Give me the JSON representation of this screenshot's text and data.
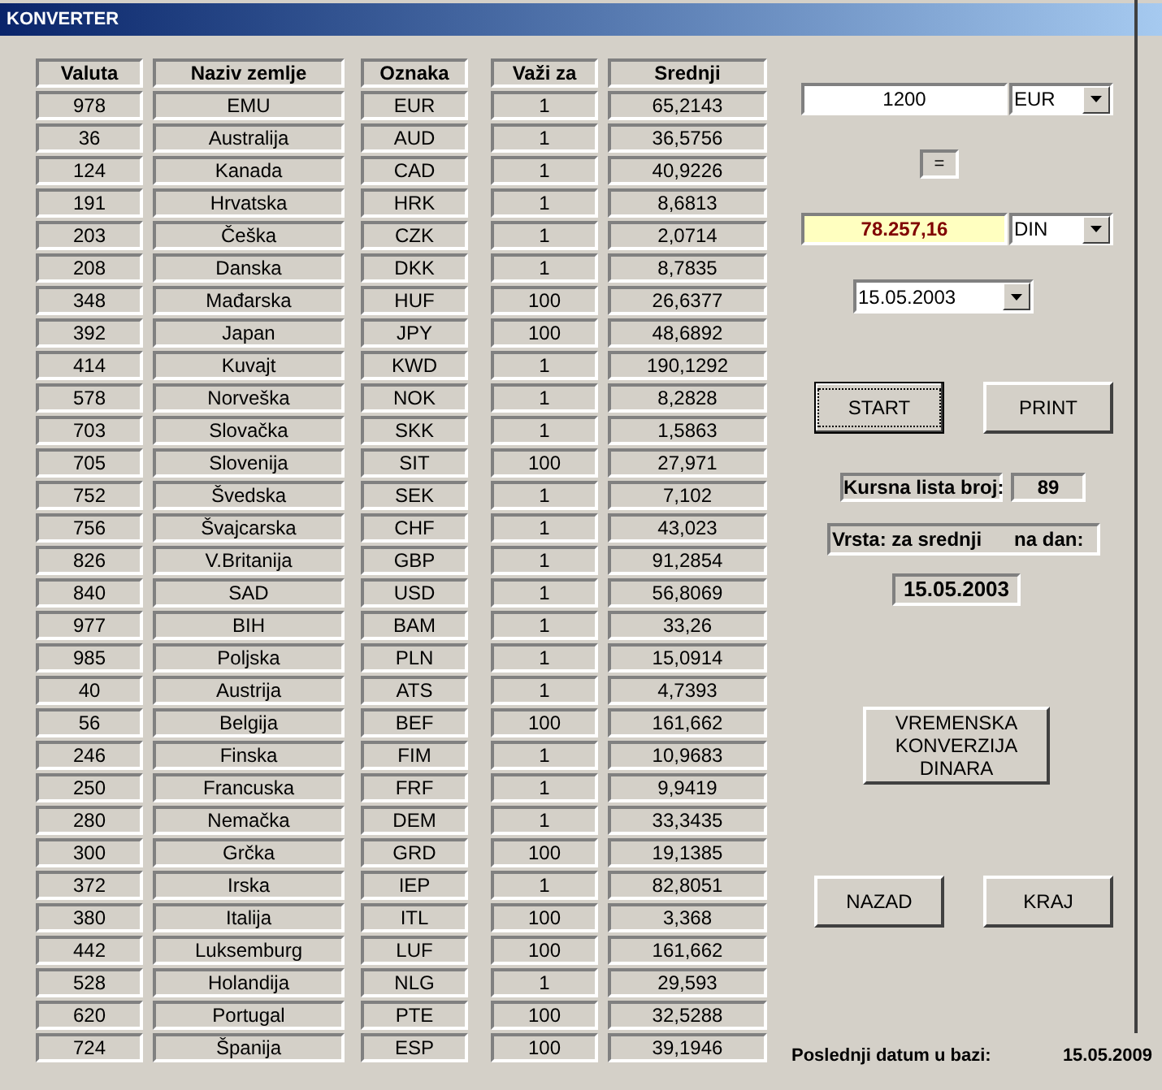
{
  "window": {
    "title": "KONVERTER"
  },
  "table": {
    "columns": [
      "Valuta",
      "Naziv zemlje",
      "Oznaka",
      "Važi za",
      "Srednji"
    ],
    "rows": [
      [
        "978",
        "EMU",
        "EUR",
        "1",
        "65,2143"
      ],
      [
        "36",
        "Australija",
        "AUD",
        "1",
        "36,5756"
      ],
      [
        "124",
        "Kanada",
        "CAD",
        "1",
        "40,9226"
      ],
      [
        "191",
        "Hrvatska",
        "HRK",
        "1",
        "8,6813"
      ],
      [
        "203",
        "Češka",
        "CZK",
        "1",
        "2,0714"
      ],
      [
        "208",
        "Danska",
        "DKK",
        "1",
        "8,7835"
      ],
      [
        "348",
        "Mađarska",
        "HUF",
        "100",
        "26,6377"
      ],
      [
        "392",
        "Japan",
        "JPY",
        "100",
        "48,6892"
      ],
      [
        "414",
        "Kuvajt",
        "KWD",
        "1",
        "190,1292"
      ],
      [
        "578",
        "Norveška",
        "NOK",
        "1",
        "8,2828"
      ],
      [
        "703",
        "Slovačka",
        "SKK",
        "1",
        "1,5863"
      ],
      [
        "705",
        "Slovenija",
        "SIT",
        "100",
        "27,971"
      ],
      [
        "752",
        "Švedska",
        "SEK",
        "1",
        "7,102"
      ],
      [
        "756",
        "Švajcarska",
        "CHF",
        "1",
        "43,023"
      ],
      [
        "826",
        "V.Britanija",
        "GBP",
        "1",
        "91,2854"
      ],
      [
        "840",
        "SAD",
        "USD",
        "1",
        "56,8069"
      ],
      [
        "977",
        "BIH",
        "BAM",
        "1",
        "33,26"
      ],
      [
        "985",
        "Poljska",
        "PLN",
        "1",
        "15,0914"
      ],
      [
        "40",
        "Austrija",
        "ATS",
        "1",
        "4,7393"
      ],
      [
        "56",
        "Belgija",
        "BEF",
        "100",
        "161,662"
      ],
      [
        "246",
        "Finska",
        "FIM",
        "1",
        "10,9683"
      ],
      [
        "250",
        "Francuska",
        "FRF",
        "1",
        "9,9419"
      ],
      [
        "280",
        "Nemačka",
        "DEM",
        "1",
        "33,3435"
      ],
      [
        "300",
        "Grčka",
        "GRD",
        "100",
        "19,1385"
      ],
      [
        "372",
        "Irska",
        "IEP",
        "1",
        "82,8051"
      ],
      [
        "380",
        "Italija",
        "ITL",
        "100",
        "3,368"
      ],
      [
        "442",
        "Luksemburg",
        "LUF",
        "100",
        "161,662"
      ],
      [
        "528",
        "Holandija",
        "NLG",
        "1",
        "29,593"
      ],
      [
        "620",
        "Portugal",
        "PTE",
        "100",
        "32,5288"
      ],
      [
        "724",
        "Španija",
        "ESP",
        "100",
        "39,1946"
      ]
    ]
  },
  "amount": {
    "value": "1200",
    "currency": "EUR"
  },
  "equals": "=",
  "result": {
    "value": "78.257,16",
    "currency": "DIN"
  },
  "date_select": "15.05.2003",
  "buttons_top": [
    {
      "label": "START",
      "focused": true
    },
    {
      "label": "PRINT",
      "focused": false
    }
  ],
  "list_number": {
    "label": "Kursna lista broj:",
    "value": "89"
  },
  "kind_label": {
    "type": "Vrsta: za srednji",
    "on_day": "na dan:"
  },
  "list_date": "15.05.2003",
  "conversion_button": "VREMENSKA KONVERZIJA DINARA",
  "buttons_bottom": [
    {
      "label": "NAZAD",
      "focused": false
    },
    {
      "label": "KRAJ",
      "focused": false
    }
  ],
  "last_date": {
    "label": "Poslednji datum u bazi:",
    "value": "15.05.2009"
  }
}
